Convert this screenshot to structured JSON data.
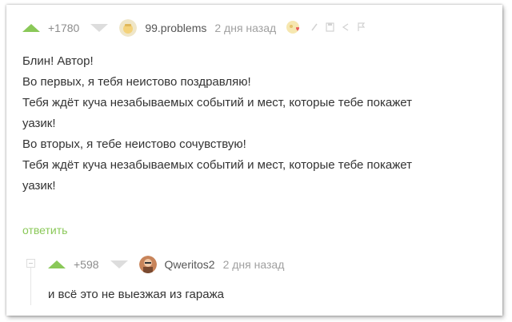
{
  "comment": {
    "votes": "+1780",
    "username": "99.problems",
    "time": "2 дня назад",
    "lines": [
      "Блин! Автор!",
      "Во первых, я тебя неистово поздравляю!",
      "Тебя ждёт куча незабываемых событий и мест, которые тебе покажет",
      "уазик!",
      "Во вторых, я тебе неистово сочувствую!",
      "Тебя ждёт куча незабываемых событий и мест, которые тебе покажет",
      "уазик!"
    ],
    "reply_label": "ответить",
    "icons": [
      "award-icon",
      "edit-icon",
      "save-icon",
      "share-icon",
      "flag-icon"
    ]
  },
  "reply": {
    "votes": "+598",
    "username": "Qweritos2",
    "time": "2 дня назад",
    "text": "и всё это не выезжая из гаража"
  },
  "colors": {
    "vote_up": "#8ac858",
    "vote_down": "#dddddd",
    "reply_link": "#8ac858",
    "meta": "#a0a0a0"
  }
}
